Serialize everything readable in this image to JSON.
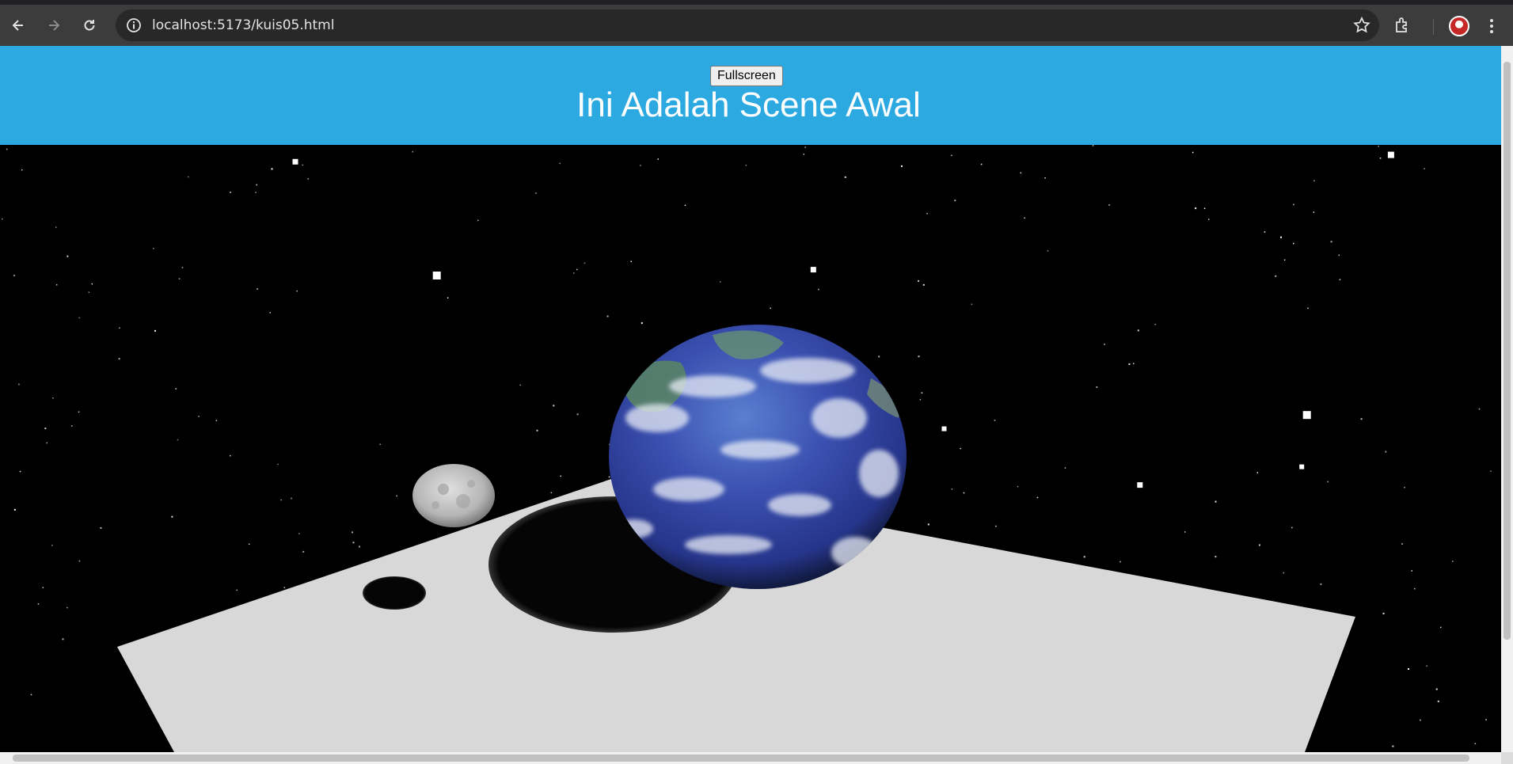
{
  "browser": {
    "url": "localhost:5173/kuis05.html",
    "icons": [
      "back-icon",
      "forward-icon",
      "reload-icon",
      "site-info-icon",
      "bookmark-star-icon",
      "extensions-icon",
      "profile-avatar",
      "menu-kebab-icon"
    ]
  },
  "page": {
    "fullscreen_label": "Fullscreen",
    "title": "Ini Adalah Scene Awal",
    "header_color": "#2ca9e1"
  },
  "scene": {
    "background_color": "#000000",
    "objects": [
      "stars",
      "ground-plane",
      "earth-sphere",
      "moon-sphere",
      "earth-shadow",
      "moon-shadow"
    ]
  }
}
